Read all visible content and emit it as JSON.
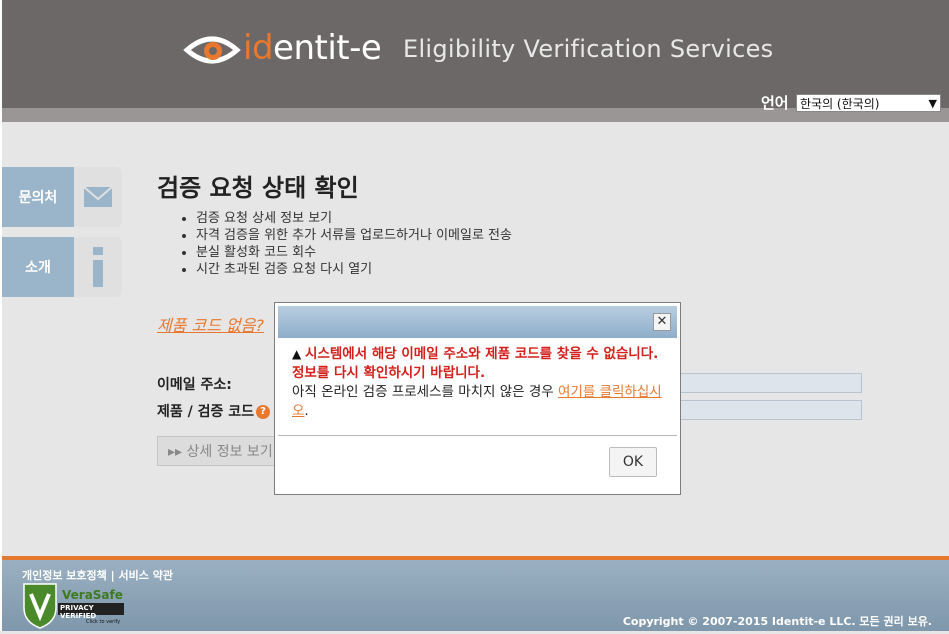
{
  "header": {
    "logo_prefix": "id",
    "logo_suffix": "entit-e",
    "tagline": "Eligibility Verification Services",
    "language_label": "언어",
    "language_selected": "한국의 (한국의)"
  },
  "sidebar": {
    "contact_label": "문의처",
    "about_label": "소개"
  },
  "main": {
    "title": "검증 요청 상태 확인",
    "bullets": [
      "검증 요청 상세 정보 보기",
      "자격 검증을 위한 추가 서류를 업로드하거나 이메일로 전송",
      "분실 활성화 코드 회수",
      "시간 초과된 검증 요청 다시 열기"
    ],
    "no_code_link": "제품 코드 없음?",
    "email_label": "이메일 주소:",
    "code_label": "제품 / 검증 코드",
    "view_button": "상세 정보 보기"
  },
  "modal": {
    "error_text": "시스템에서 해당 이메일 주소와 제품 코드를 찾을 수 없습니다. 정보를 다시 확인하시기 바랍니다.",
    "info_text": "아직 온라인 검증 프로세스를 마치지 않은 경우 ",
    "link_text": "여기를 클릭하십시오",
    "info_end": ".",
    "ok_label": "OK"
  },
  "footer": {
    "privacy_link": "개인정보 보호정책",
    "separator": "|",
    "terms_link": "서비스 약관",
    "copyright": "Copyright © 2007-2015 Identit-e LLC. 모든 권리 보유.",
    "badge_name": "VeraSafe",
    "badge_caption": "PRIVACY VERIFIED",
    "badge_sub": "Click to verify"
  },
  "colors": {
    "accent": "#e8782e",
    "header": "#6d6868",
    "side": "#9ab4c9",
    "error": "#d4201c"
  }
}
